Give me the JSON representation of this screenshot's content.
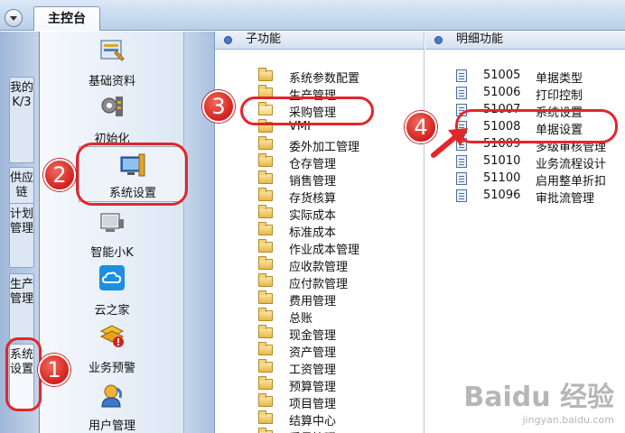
{
  "topbar": {
    "main_tab": "主控台"
  },
  "left_tabs": [
    {
      "label": "我的K/3"
    },
    {
      "label": "供应链"
    },
    {
      "label": "计划管理"
    },
    {
      "label": "生产管理"
    },
    {
      "label": "系统设置"
    }
  ],
  "icon_panel": [
    {
      "label": "基础资料",
      "icon": "database-icon"
    },
    {
      "label": "初始化",
      "icon": "gear-init-icon"
    },
    {
      "label": "系统设置",
      "icon": "system-settings-icon"
    },
    {
      "label": "智能小K",
      "icon": "smart-assistant-icon"
    },
    {
      "label": "云之家",
      "icon": "cloud-icon"
    },
    {
      "label": "业务预警",
      "icon": "warning-icon"
    },
    {
      "label": "用户管理",
      "icon": "user-admin-icon"
    }
  ],
  "sub_panel": {
    "header": "子功能",
    "items": [
      "系统参数配置",
      "生产管理",
      "采购管理",
      "VMI",
      "委外加工管理",
      "仓存管理",
      "销售管理",
      "存货核算",
      "实际成本",
      "标准成本",
      "作业成本管理",
      "应收款管理",
      "应付款管理",
      "费用管理",
      "总账",
      "现金管理",
      "资产管理",
      "工资管理",
      "预算管理",
      "项目管理",
      "结算中心",
      "质量管理"
    ]
  },
  "detail_panel": {
    "header": "明细功能",
    "items": [
      {
        "code": "51005",
        "label": "单据类型"
      },
      {
        "code": "51006",
        "label": "打印控制"
      },
      {
        "code": "51007",
        "label": "系统设置"
      },
      {
        "code": "51008",
        "label": "单据设置"
      },
      {
        "code": "51009",
        "label": "多级审核管理"
      },
      {
        "code": "51010",
        "label": "业务流程设计"
      },
      {
        "code": "51100",
        "label": "启用整单折扣"
      },
      {
        "code": "51096",
        "label": "审批流管理"
      }
    ]
  },
  "annotations": {
    "n1": "1",
    "n2": "2",
    "n3": "3",
    "n4": "4"
  },
  "watermark": {
    "logo": "Baidu 经验",
    "sub": "jingyan.baidu.com"
  },
  "colors": {
    "annotation_red": "#e3262a",
    "frame_blue": "#a9c0df"
  }
}
